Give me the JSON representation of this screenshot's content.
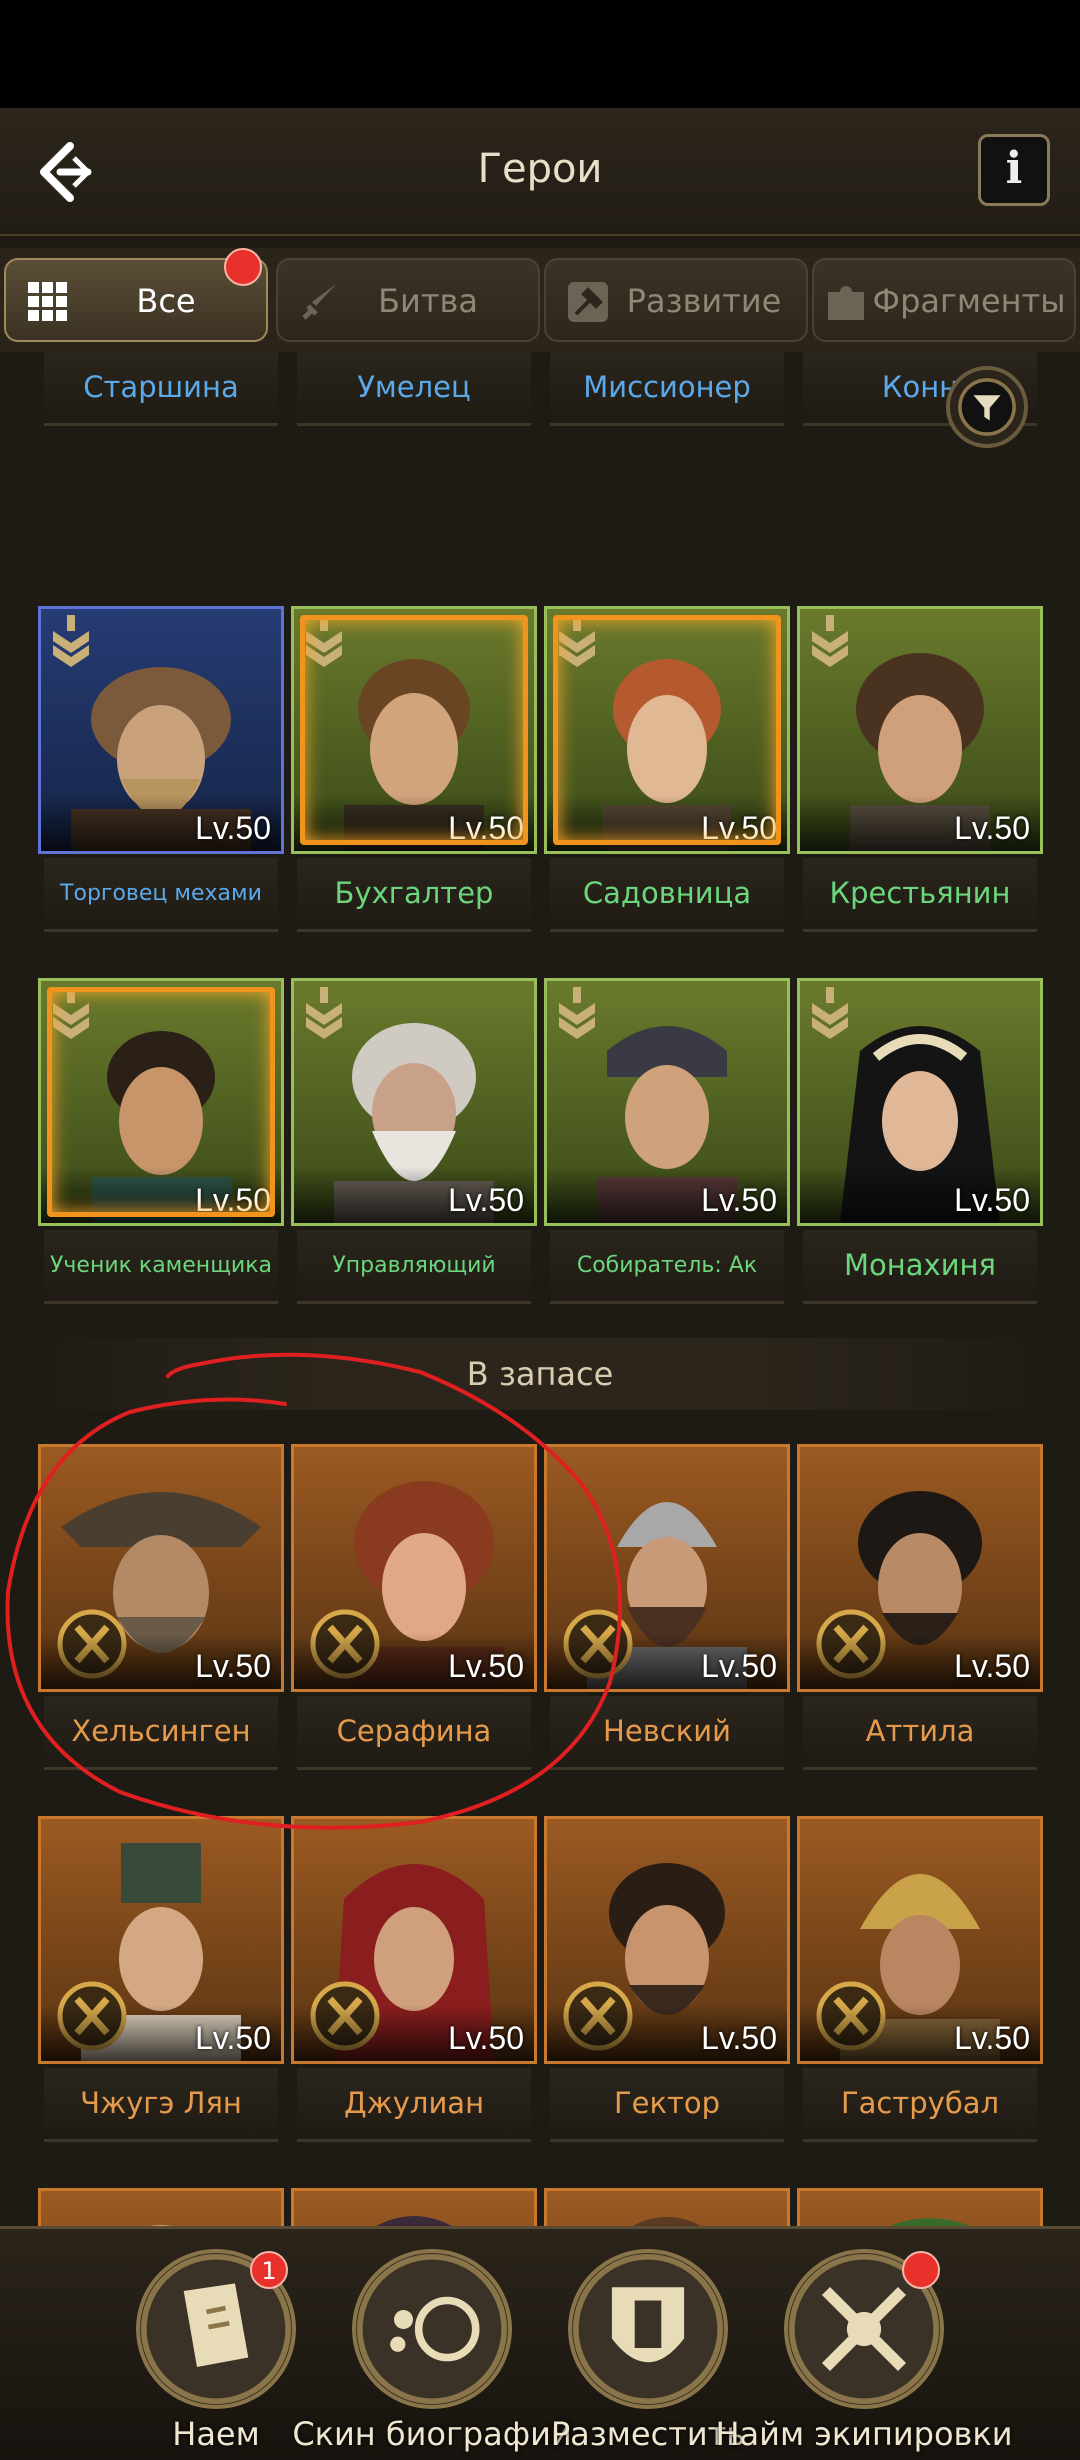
{
  "header": {
    "title": "Герои",
    "back_icon": "back-arrow-icon",
    "info_label": "i"
  },
  "tabs": [
    {
      "label": "Все",
      "icon": "grid-icon",
      "active": true,
      "badge": true
    },
    {
      "label": "Битва",
      "icon": "sword-icon",
      "active": false
    },
    {
      "label": "Развитие",
      "icon": "hammer-icon",
      "active": false
    },
    {
      "label": "Фрагменты",
      "icon": "puzzle-icon",
      "active": false
    }
  ],
  "top_partial_names": [
    "Старшина",
    "Умелец",
    "Миссионер",
    "Конн"
  ],
  "active_heroes_row1": [
    {
      "name": "Торговец мехами",
      "level": "Lv.50",
      "rarity": "blue"
    },
    {
      "name": "Бухгалтер",
      "level": "Lv.50",
      "rarity": "green"
    },
    {
      "name": "Садовница",
      "level": "Lv.50",
      "rarity": "green"
    },
    {
      "name": "Крестьянин",
      "level": "Lv.50",
      "rarity": "green"
    }
  ],
  "active_heroes_row2": [
    {
      "name": "Ученик каменщика",
      "level": "Lv.50",
      "rarity": "green"
    },
    {
      "name": "Управляющий",
      "level": "Lv.50",
      "rarity": "green"
    },
    {
      "name": "Собиратель: Ак",
      "level": "Lv.50",
      "rarity": "green"
    },
    {
      "name": "Монахиня",
      "level": "Lv.50",
      "rarity": "green"
    }
  ],
  "reserve_section": {
    "title": "В запасе"
  },
  "reserve_heroes_row1": [
    {
      "name": "Хельсинген",
      "level": "Lv.50"
    },
    {
      "name": "Серафина",
      "level": "Lv.50"
    },
    {
      "name": "Невский",
      "level": "Lv.50"
    },
    {
      "name": "Аттила",
      "level": "Lv.50"
    }
  ],
  "reserve_heroes_row2": [
    {
      "name": "Чжугэ Лян",
      "level": "Lv.50"
    },
    {
      "name": "Джулиан",
      "level": "Lv.50"
    },
    {
      "name": "Гектор",
      "level": "Lv.50"
    },
    {
      "name": "Гаструбал",
      "level": "Lv.50"
    }
  ],
  "bottom_nav": [
    {
      "label": "Наем",
      "icon": "recruit-book-icon",
      "badge": "1"
    },
    {
      "label": "Скин биографии",
      "icon": "skin-icon"
    },
    {
      "label": "Разместить",
      "icon": "tower-shield-icon"
    },
    {
      "label": "Найм экипировки",
      "icon": "equipment-icon",
      "badge_dot": true
    }
  ],
  "colors": {
    "accent": "#e8312a",
    "blue_rarity": "#5f72d6",
    "green_rarity": "#97c05a",
    "orange_rarity": "#c9792f",
    "annotation": "#e02020"
  }
}
